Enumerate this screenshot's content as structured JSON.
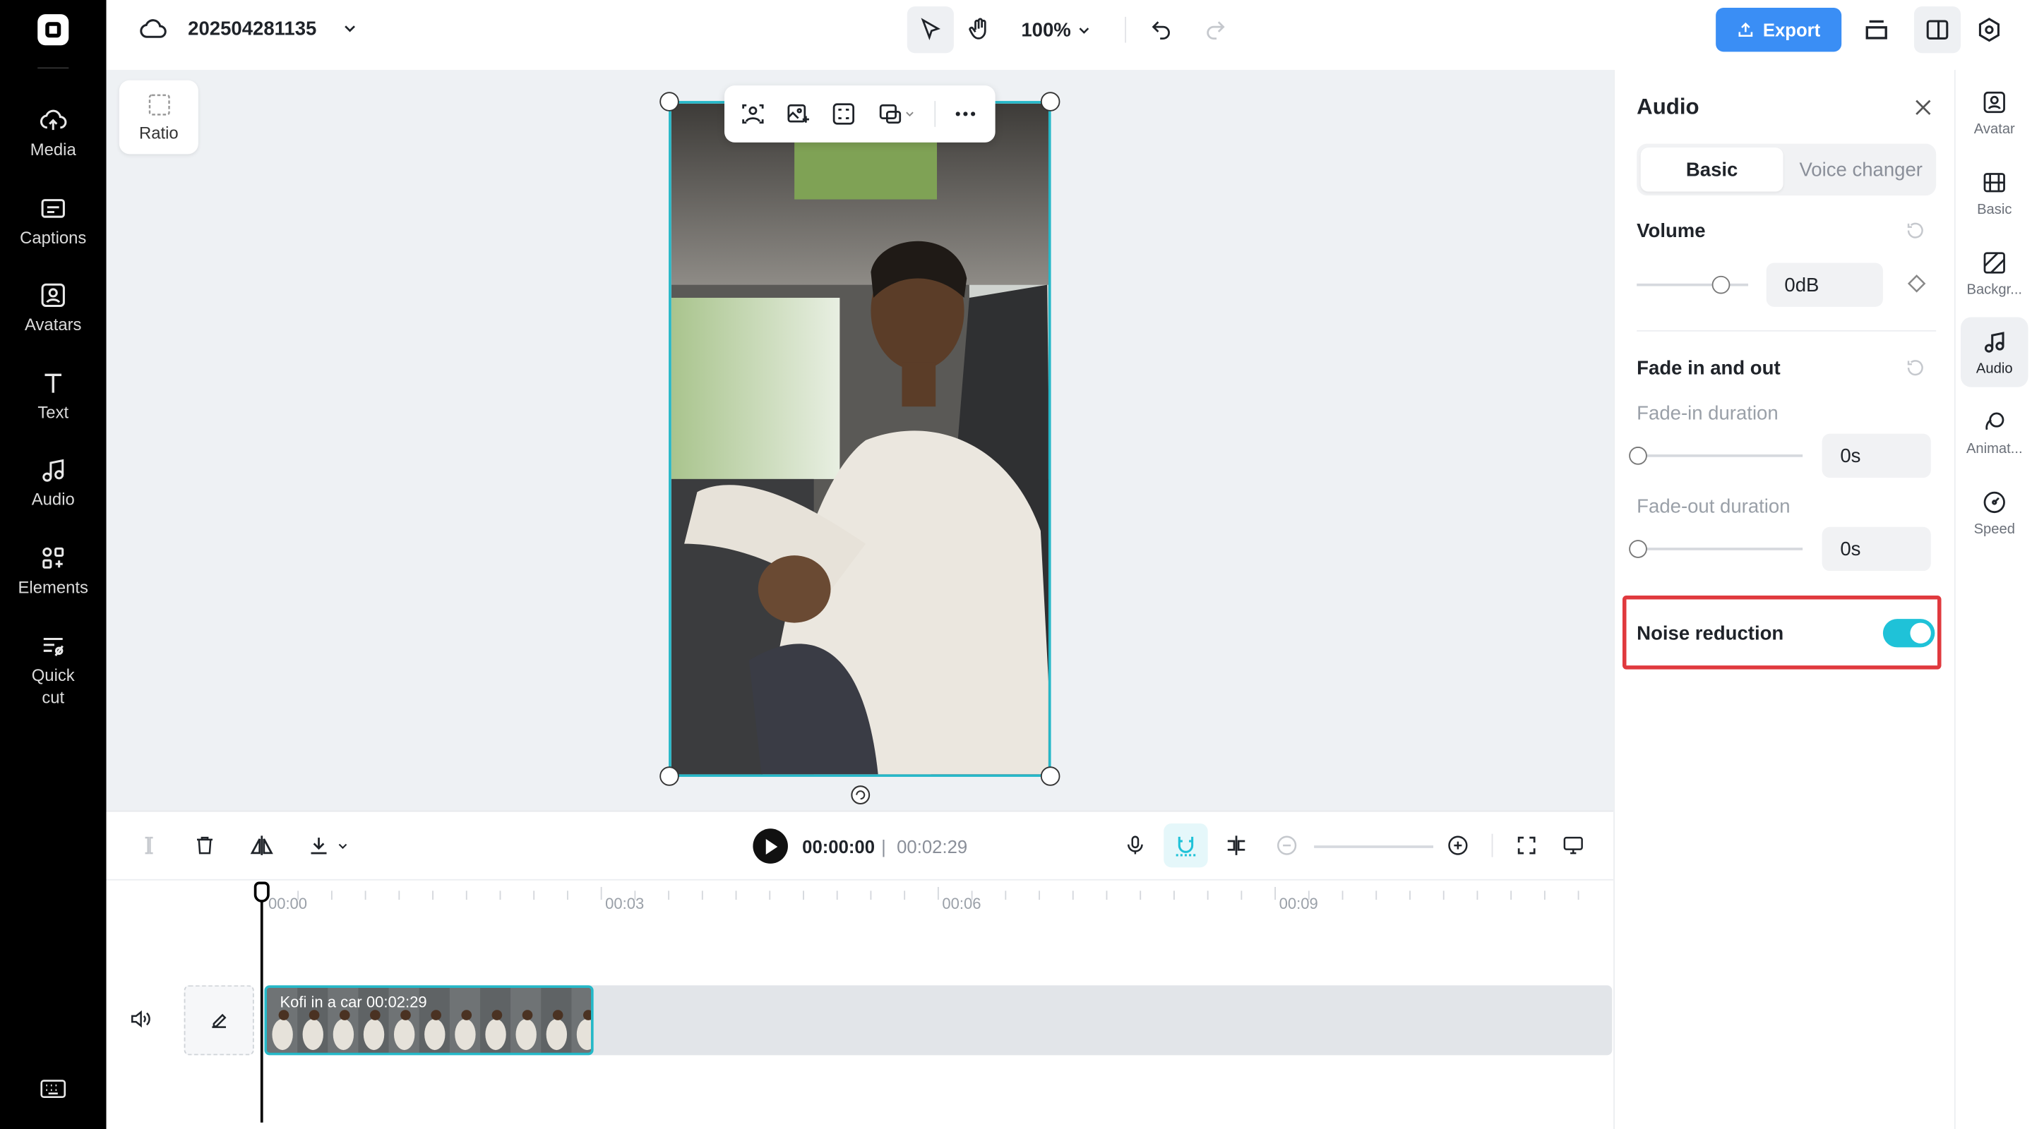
{
  "header": {
    "project_name": "202504281135",
    "zoom": "100%",
    "export_label": "Export"
  },
  "left_nav": [
    {
      "label": "Media",
      "icon": "cloud-upload-icon"
    },
    {
      "label": "Captions",
      "icon": "captions-icon"
    },
    {
      "label": "Avatars",
      "icon": "avatar-icon"
    },
    {
      "label": "Text",
      "icon": "text-icon"
    },
    {
      "label": "Audio",
      "icon": "music-note-icon"
    },
    {
      "label": "Elements",
      "icon": "elements-icon"
    },
    {
      "label": "Quick cut",
      "icon": "quick-cut-icon"
    }
  ],
  "canvas": {
    "ratio_label": "Ratio"
  },
  "timeline": {
    "current_time": "00:00:00",
    "separator": "|",
    "total_time": "00:02:29",
    "ticks": [
      "00:00",
      "00:03",
      "00:06",
      "00:09"
    ],
    "clip_label": "Kofi in a car",
    "clip_duration": "00:02:29"
  },
  "audio_panel": {
    "title": "Audio",
    "tabs": [
      "Basic",
      "Voice changer"
    ],
    "volume": {
      "label": "Volume",
      "value": "0dB",
      "slider_fraction": 0.75
    },
    "fade": {
      "label": "Fade in and out",
      "fade_in_label": "Fade-in duration",
      "fade_in_value": "0s",
      "fade_out_label": "Fade-out duration",
      "fade_out_value": "0s"
    },
    "noise_reduction": {
      "label": "Noise reduction",
      "enabled": true
    }
  },
  "right_rail": [
    {
      "label": "Avatar",
      "icon": "avatar-icon"
    },
    {
      "label": "Basic",
      "icon": "film-icon"
    },
    {
      "label": "Backgr...",
      "icon": "background-icon"
    },
    {
      "label": "Audio",
      "icon": "music-note-icon",
      "active": true
    },
    {
      "label": "Animat...",
      "icon": "animation-icon"
    },
    {
      "label": "Speed",
      "icon": "speed-icon"
    }
  ],
  "colors": {
    "accent": "#1fc2d8",
    "export": "#3a8ef5",
    "highlight": "#e0393e",
    "selection": "#25b8c8"
  }
}
